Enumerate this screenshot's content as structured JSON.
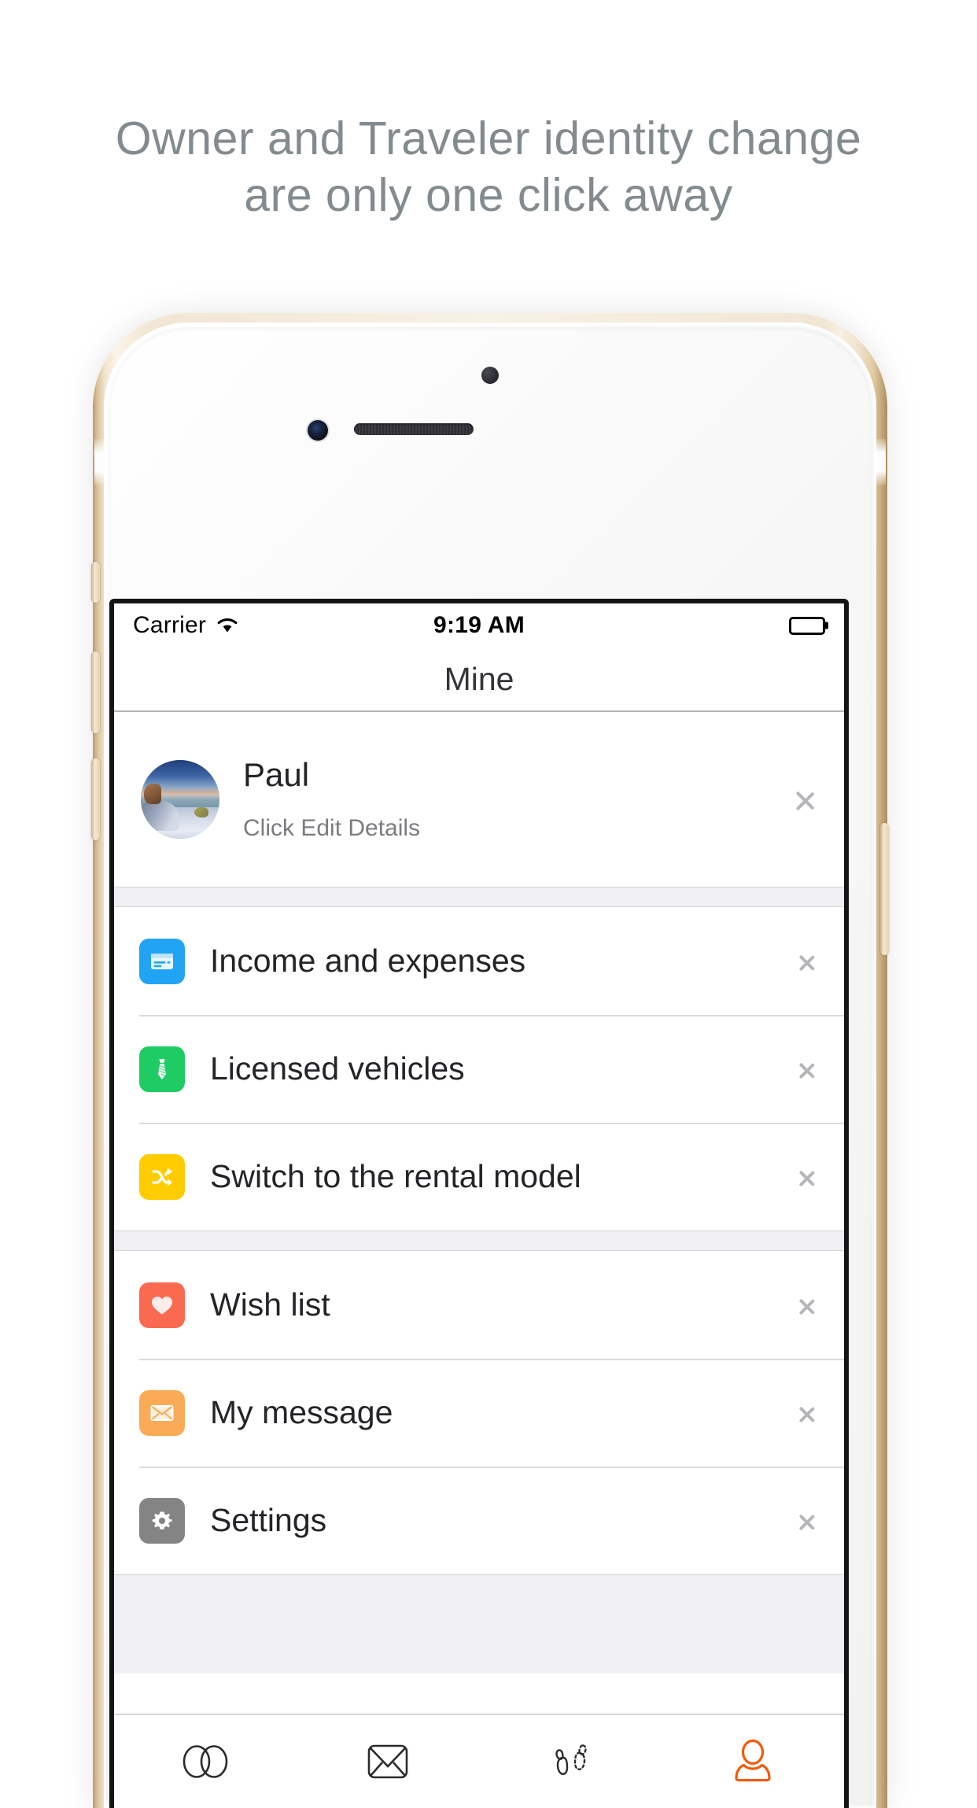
{
  "headline": {
    "line1": "Owner and Traveler identity change",
    "line2": "are only one click away",
    "color": "#838B8F"
  },
  "status_bar": {
    "carrier": "Carrier",
    "wifi_icon": "wifi-icon",
    "time": "9:19 AM",
    "battery_icon": "battery-full-icon"
  },
  "nav_bar": {
    "title": "Mine"
  },
  "profile": {
    "avatar_icon": "user-avatar-photo",
    "name": "Paul",
    "subtitle": "Click Edit Details",
    "chevron_icon": "chevron-right-icon"
  },
  "groups": [
    {
      "rows": [
        {
          "icon": "credit-card-icon",
          "icon_color": "#22A4F4",
          "label": "Income and expenses",
          "chevron_icon": "chevron-right-icon"
        },
        {
          "icon": "necktie-icon",
          "icon_color": "#1ECC63",
          "label": "Licensed vehicles",
          "chevron_icon": "chevron-right-icon"
        },
        {
          "icon": "shuffle-icon",
          "icon_color": "#FFCC00",
          "label": "Switch to the rental model",
          "chevron_icon": "chevron-right-icon"
        }
      ]
    },
    {
      "rows": [
        {
          "icon": "heart-icon",
          "icon_color": "#FA6A50",
          "label": "Wish list",
          "chevron_icon": "chevron-right-icon"
        },
        {
          "icon": "envelope-icon",
          "icon_color": "#F9AB55",
          "label": "My message",
          "chevron_icon": "chevron-right-icon"
        },
        {
          "icon": "gear-icon",
          "icon_color": "#848484",
          "label": "Settings",
          "chevron_icon": "chevron-right-icon"
        }
      ]
    }
  ],
  "tab_bar": {
    "active_color": "#F4590C",
    "inactive_color": "#2B2B2B",
    "tabs": [
      {
        "icon": "double-circle-icon",
        "active": false
      },
      {
        "icon": "envelope-outline-icon",
        "active": false
      },
      {
        "icon": "footprints-icon",
        "active": false
      },
      {
        "icon": "person-icon",
        "active": true
      }
    ]
  },
  "device": {
    "frame_color": "#F2E6D4",
    "body_label": "iphone-gold-device"
  }
}
